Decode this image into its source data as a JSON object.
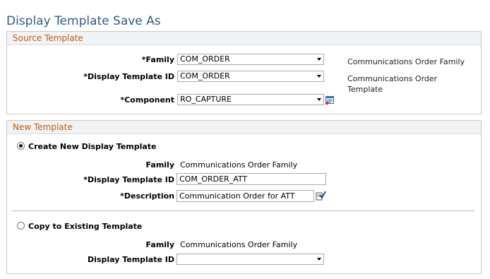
{
  "page": {
    "title": "Display Template Save As"
  },
  "source": {
    "title": "Source Template",
    "family_label": "*Family",
    "family_value": "COM_ORDER",
    "family_desc": "Communications Order Family",
    "dt_label": "*Display Template ID",
    "dt_value": "COM_ORDER",
    "dt_desc_line1": "Communications Order",
    "dt_desc_line2": "Template",
    "component_label": "*Component",
    "component_value": "RO_CAPTURE",
    "lookup_icon": "prompt-lookup-icon"
  },
  "new_template": {
    "title": "New Template",
    "create_label": "Create New Display Template",
    "create_selected": true,
    "family_label": "Family",
    "family_value": "Communications Order Family",
    "dt_label": "*Display Template ID",
    "dt_value": "COM_ORDER_ATT",
    "desc_label": "*Description",
    "desc_value": "Communication Order for ATT",
    "spellcheck_icon": "spell-check-icon",
    "copy_label": "Copy to Existing Template",
    "copy_selected": false,
    "copy_family_label": "Family",
    "copy_family_value": "Communications Order Family",
    "copy_dt_label": "Display Template ID",
    "copy_dt_value": ""
  },
  "colors": {
    "title_blue": "#345a85",
    "group_title_orange": "#c05d13",
    "group_header_bg": "#f0f2f4"
  }
}
